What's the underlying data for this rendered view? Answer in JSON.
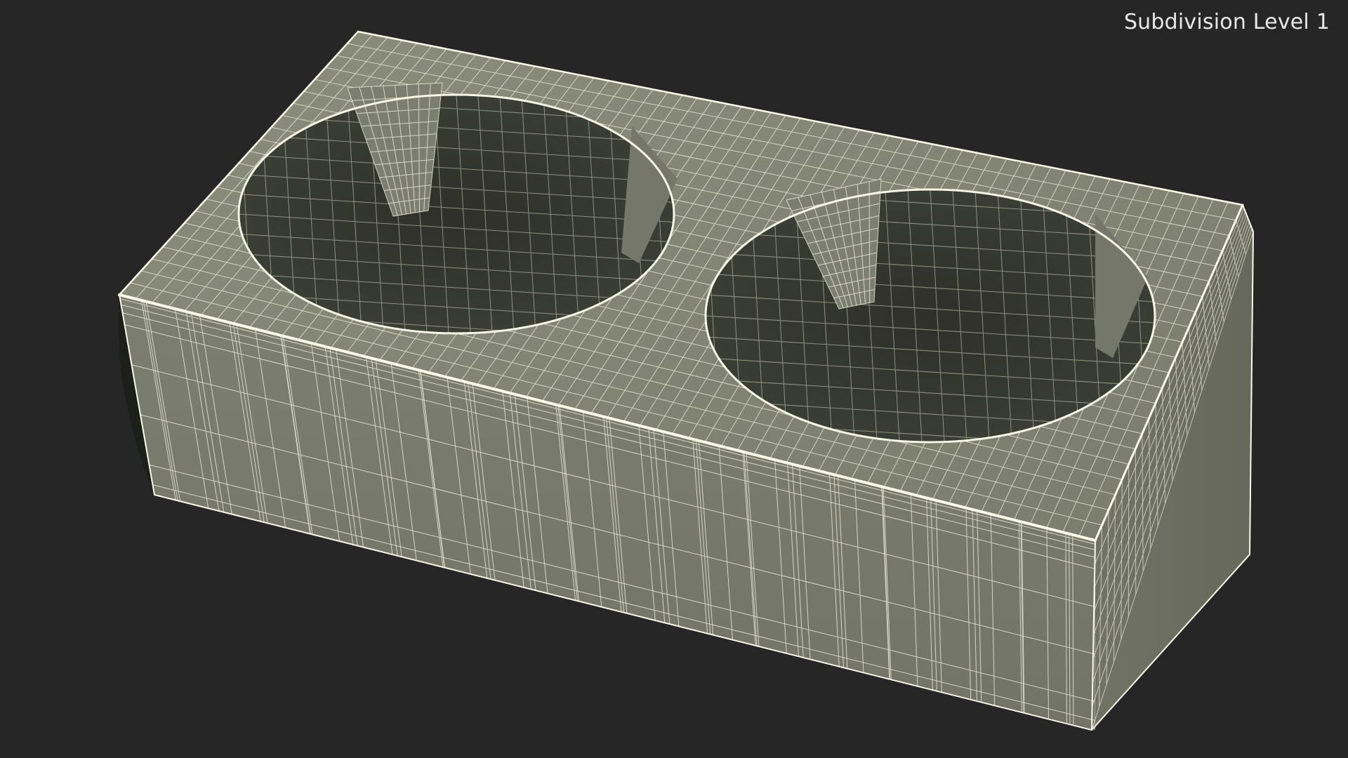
{
  "viewport": {
    "label": "Subdivision Level 1",
    "background": "#262626"
  },
  "model": {
    "shading": "wireframe-on-shaded",
    "surface_color": "#7b7d6e",
    "inner_color": "#3a3c33",
    "wire_color": "#f2f1dc",
    "cup_holes": 2
  }
}
